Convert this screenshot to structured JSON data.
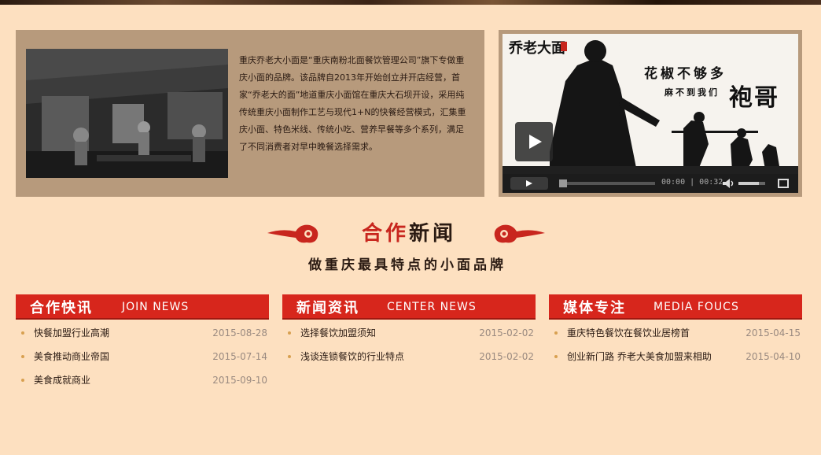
{
  "about": {
    "text": "重庆乔老大小面是“重庆南粉北面餐饮管理公司”旗下专做重庆小面的品牌。该品牌自2013年开始创立并开店经营，首家“乔老大的面”地道重庆小面馆在重庆大石坝开设，采用纯传统重庆小面制作工艺与现代1+N的快餐经营模式，汇集重庆小面、特色米线、传统小吃、营养早餐等多个系列，满足了不同消费者对早中晚餐选择需求。"
  },
  "video": {
    "logo": "乔老大面",
    "slogan_line1": "花椒不够多",
    "slogan_line2": "麻不到我们",
    "slogan_brand": "袍哥",
    "time_current": "00:00",
    "time_total": "00:32"
  },
  "section": {
    "title_part1": "合作",
    "title_part2": "新闻",
    "subtitle": "做重庆最具特点的小面品牌"
  },
  "columns": [
    {
      "title_zh": "合作快讯",
      "title_en": "JOIN NEWS",
      "items": [
        {
          "title": "快餐加盟行业高潮",
          "date": "2015-08-28"
        },
        {
          "title": "美食推动商业帝国",
          "date": "2015-07-14"
        },
        {
          "title": "美食成就商业",
          "date": "2015-09-10"
        }
      ]
    },
    {
      "title_zh": "新闻资讯",
      "title_en": "CENTER NEWS",
      "items": [
        {
          "title": "选择餐饮加盟须知",
          "date": "2015-02-02"
        },
        {
          "title": "浅谈连锁餐饮的行业特点",
          "date": "2015-02-02"
        }
      ]
    },
    {
      "title_zh": "媒体专注",
      "title_en": "MEDIA FOUCS",
      "items": [
        {
          "title": "重庆特色餐饮在餐饮业居榜首",
          "date": "2015-04-15"
        },
        {
          "title": "创业新门路 乔老大美食加盟来相助",
          "date": "2015-04-10"
        }
      ]
    }
  ],
  "colors": {
    "background": "#fde0c0",
    "panel": "#b79a7c",
    "accent_red": "#d7261c",
    "bullet": "#d8a050"
  }
}
